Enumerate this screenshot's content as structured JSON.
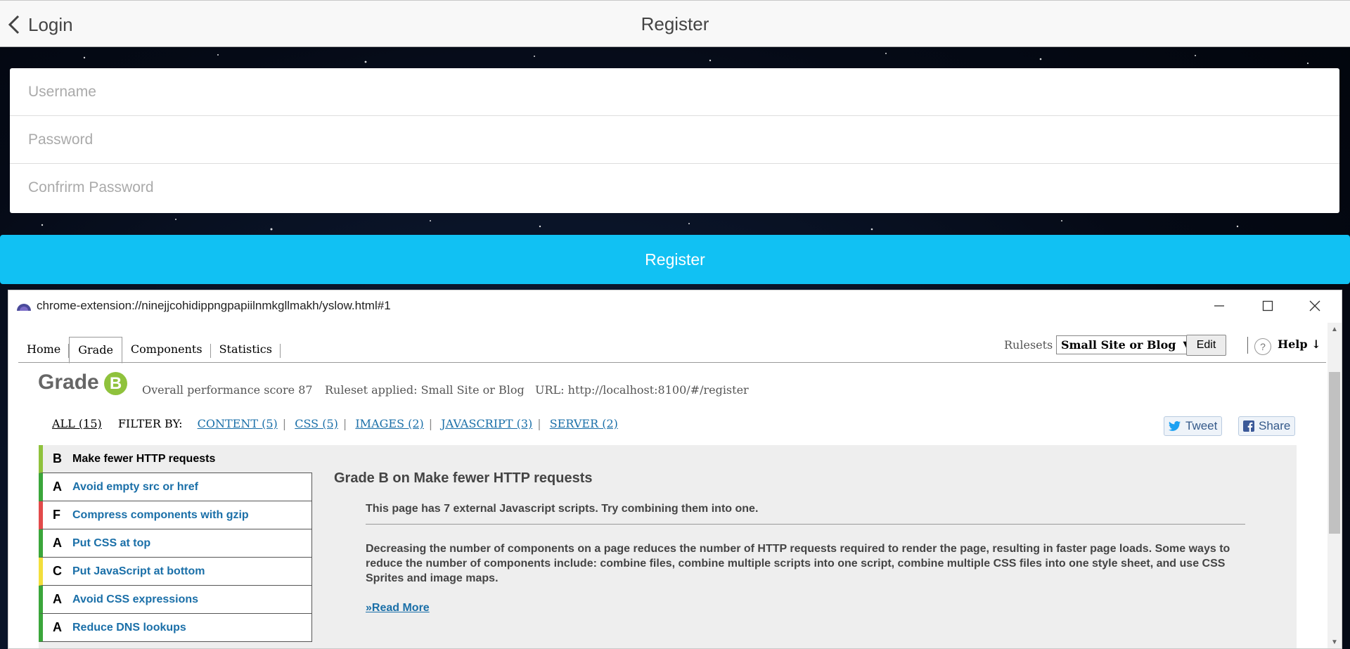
{
  "header": {
    "back_label": "Login",
    "title": "Register"
  },
  "form": {
    "username_placeholder": "Username",
    "password_placeholder": "Password",
    "confirm_placeholder": "Confrirm Password",
    "submit_label": "Register"
  },
  "popup": {
    "url": "chrome-extension://ninejjcohidippngpapiilnmkgllmakh/yslow.html#1",
    "tabs": [
      "Home",
      "Grade",
      "Components",
      "Statistics"
    ],
    "active_tab": "Grade",
    "rulesets_label": "Rulesets",
    "ruleset_selected": "Small Site or Blog",
    "edit_label": "Edit",
    "help_label": "Help ↓",
    "grade_label": "Grade",
    "grade_letter": "B",
    "score_text": "Overall performance score 87",
    "ruleset_text": "Ruleset applied: Small Site or Blog",
    "url_text": "URL: http://localhost:8100/#/register",
    "filter": {
      "all_label": "ALL (15)",
      "filter_by_label": "FILTER BY:",
      "links": [
        "CONTENT (5)",
        "CSS (5)",
        "IMAGES (2)",
        "JAVASCRIPT (3)",
        "SERVER (2)"
      ]
    },
    "tweet_label": "Tweet",
    "share_label": "Share",
    "rules": [
      {
        "grade": "B",
        "label": "Make fewer HTTP requests",
        "color": "#8fc23c"
      },
      {
        "grade": "A",
        "label": "Avoid empty src or href",
        "color": "#3aa63a"
      },
      {
        "grade": "F",
        "label": "Compress components with gzip",
        "color": "#e24a4a"
      },
      {
        "grade": "A",
        "label": "Put CSS at top",
        "color": "#3aa63a"
      },
      {
        "grade": "C",
        "label": "Put JavaScript at bottom",
        "color": "#f3df3c"
      },
      {
        "grade": "A",
        "label": "Avoid CSS expressions",
        "color": "#3aa63a"
      },
      {
        "grade": "A",
        "label": "Reduce DNS lookups",
        "color": "#3aa63a"
      }
    ],
    "detail": {
      "title": "Grade B on Make fewer HTTP requests",
      "summary": "This page has 7 external Javascript scripts. Try combining them into one.",
      "body": "Decreasing the number of components on a page reduces the number of HTTP requests required to render the page, resulting in faster page loads. Some ways to reduce the number of components include: combine files, combine multiple scripts into one script, combine multiple CSS files into one style sheet, and use CSS Sprites and image maps.",
      "read_more": "»Read More"
    }
  }
}
